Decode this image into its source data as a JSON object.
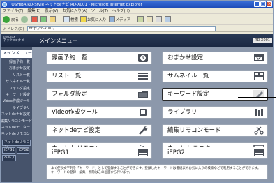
{
  "browser": {
    "title": "TOSHIBA RD-Style ネットdeナビ RD-X001 - Microsoft Internet Explorer",
    "menu": [
      "ファイル(F)",
      "編集(E)",
      "表示(V)",
      "お気に入り(A)",
      "ツール(T)",
      "ヘルプ(H)"
    ],
    "toolbar": {
      "back_label": "戻る",
      "search_label": "検索",
      "favorites_label": "お気に入り",
      "media_label": "メディア"
    },
    "address_label": "アドレス(D)",
    "address_value": "http://rd-x001/"
  },
  "app": {
    "brand_line1": "TOSHIBA",
    "brand_line2": "ネットdeナビ",
    "page_title": "メインメニュー",
    "model_badge": "RD-X001"
  },
  "sidebar": {
    "active_label": "メインメニュー",
    "items": [
      "録画予約一覧",
      "おまかせ設定",
      "リスト一覧",
      "サムネイル一覧",
      "フォルダ設定",
      "キーワード設定",
      "Video作成ツール",
      "ライブラリ",
      "ネットdeナビ設定",
      "編集リモコンモード",
      "ネットdeモニター",
      "ネットdeリモコン"
    ],
    "buttons": {
      "remote": "ネットdeリモコン",
      "epg1": "iEPG1",
      "epg2": "iEPG2",
      "help": "ヘルプ"
    }
  },
  "menu": {
    "tiles": [
      {
        "label": "録画予約一覧",
        "icon": "clock-icon"
      },
      {
        "label": "おまかせ設定",
        "icon": "calendar-icon"
      },
      {
        "label": "リスト一覧",
        "icon": "list-icon"
      },
      {
        "label": "サムネイル一覧",
        "icon": "thumbnails-icon"
      },
      {
        "label": "フォルダ設定",
        "icon": "folder-icon"
      },
      {
        "label": "キーワード設定",
        "icon": "pencil-icon"
      },
      {
        "label": "Video作成ツール",
        "icon": "video-tool-icon"
      },
      {
        "label": "ライブラリ",
        "icon": "books-icon"
      },
      {
        "label": "ネットdeナビ設定",
        "icon": "wrench-icon"
      },
      {
        "label": "編集リモコンモード",
        "icon": "scissors-icon"
      },
      {
        "label": "ネットdeリモコン",
        "icon": "remote-icon"
      },
      {
        "label": "ネットdeモニター",
        "icon": "monitor-icon"
      },
      {
        "label": "iEPG1",
        "icon": "epg-icon"
      },
      {
        "label": "iEPG2",
        "icon": "epg-icon"
      }
    ],
    "highlighted": "キーワード設定",
    "info_text": "よく使う文字列を「キーワード」として登録することができます。登録したキーワードは番組表やお気に入りの検索などで利用することができます。キーワードの登録・編集・削除はこの画面から行います。"
  },
  "colors": {
    "header_bg": "#1b2842",
    "sidebar_bg": "#46536b",
    "main_bg": "#8c98ab",
    "tile_bg": "#ffffff"
  }
}
